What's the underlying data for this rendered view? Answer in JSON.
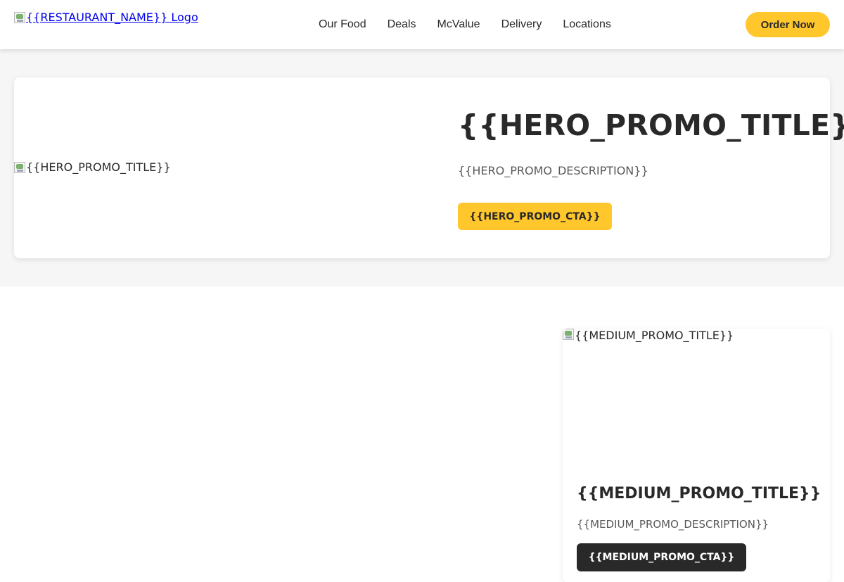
{
  "header": {
    "logo_alt": "{{RESTAURANT_NAME}} Logo",
    "nav": [
      {
        "label": "Our Food"
      },
      {
        "label": "Deals"
      },
      {
        "label": "McValue"
      },
      {
        "label": "Delivery"
      },
      {
        "label": "Locations"
      }
    ],
    "order_button": "Order Now"
  },
  "hero": {
    "image_alt": "{{HERO_PROMO_TITLE}}",
    "title": "{{HERO_PROMO_TITLE}}",
    "description": "{{HERO_PROMO_DESCRIPTION}}",
    "cta": "{{HERO_PROMO_CTA}}"
  },
  "medium_promo": {
    "image_alt": "{{MEDIUM_PROMO_TITLE}}",
    "title": "{{MEDIUM_PROMO_TITLE}}",
    "description": "{{MEDIUM_PROMO_DESCRIPTION}}",
    "cta": "{{MEDIUM_PROMO_CTA}}"
  },
  "colors": {
    "brand_yellow": "#ffc72c",
    "text_dark": "#292929",
    "text_muted": "#595959",
    "section_bg": "#f6f6f6",
    "link_blue": "#0000ee"
  }
}
